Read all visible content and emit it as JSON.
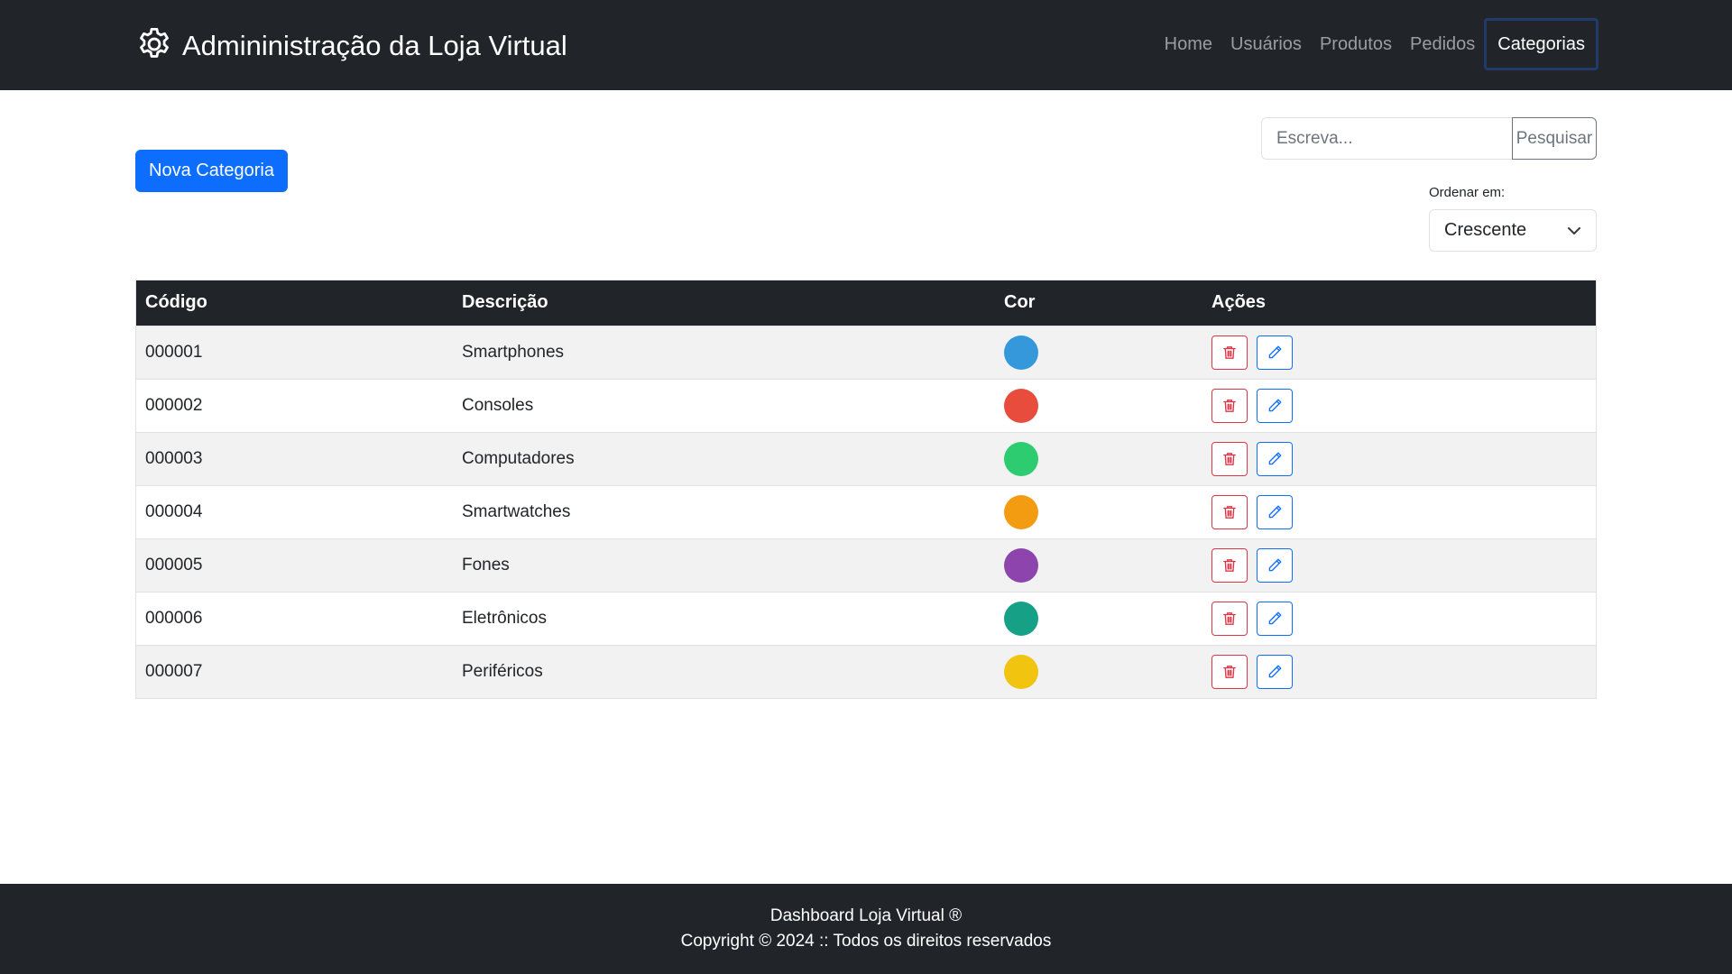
{
  "navbar": {
    "brand_icon": "gear-icon",
    "brand_title": "Admininistração da Loja Virtual",
    "links": [
      {
        "label": "Home",
        "active": false
      },
      {
        "label": "Usuários",
        "active": false
      },
      {
        "label": "Produtos",
        "active": false
      },
      {
        "label": "Pedidos",
        "active": false
      },
      {
        "label": "Categorias",
        "active": true
      }
    ]
  },
  "toolbar": {
    "new_button_label": "Nova Categoria",
    "search_placeholder": "Escreva...",
    "search_button_label": "Pesquisar",
    "sort_label": "Ordenar em:",
    "sort_value": "Crescente"
  },
  "table": {
    "headers": [
      "Código",
      "Descrição",
      "Cor",
      "Ações"
    ],
    "rows": [
      {
        "code": "000001",
        "description": "Smartphones",
        "color": "#3498db"
      },
      {
        "code": "000002",
        "description": "Consoles",
        "color": "#e74c3c"
      },
      {
        "code": "000003",
        "description": "Computadores",
        "color": "#2ecc71"
      },
      {
        "code": "000004",
        "description": "Smartwatches",
        "color": "#f39c12"
      },
      {
        "code": "000005",
        "description": "Fones",
        "color": "#8e44ad"
      },
      {
        "code": "000006",
        "description": "Eletrônicos",
        "color": "#16a085"
      },
      {
        "code": "000007",
        "description": "Periféricos",
        "color": "#f1c40f"
      }
    ],
    "action_icons": {
      "delete": "trash-icon",
      "edit": "pencil-icon"
    }
  },
  "colors": {
    "navbar_bg": "#212529",
    "primary": "#0d6efd",
    "danger": "#dc3545"
  },
  "footer": {
    "line1": "Dashboard Loja Virtual ®",
    "line2": "Copyright © 2024 :: Todos os direitos reservados"
  }
}
